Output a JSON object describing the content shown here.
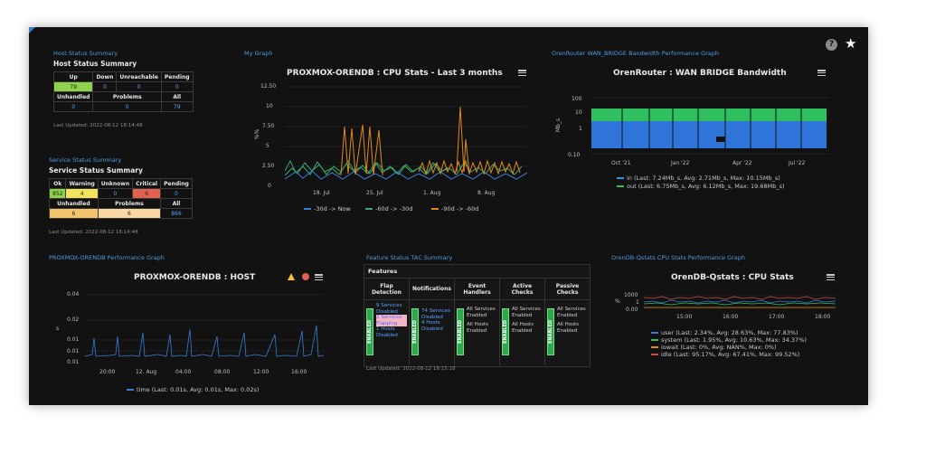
{
  "header": {
    "help_icon": "question-circle-icon",
    "star_icon": "star-icon",
    "help_glyph": "?",
    "star_glyph": "★"
  },
  "host_status": {
    "dashlet_title": "Host Status Summary",
    "heading": "Host Status Summary",
    "headers": [
      "Up",
      "Down",
      "Unreachable",
      "Pending"
    ],
    "values": [
      "79",
      "0",
      "0",
      "0"
    ],
    "sub_headers": [
      "Unhandled",
      "Problems",
      "All"
    ],
    "sub_values": [
      "0",
      "0",
      "79"
    ],
    "updated": "Last Updated: 2022-08-12 18:14:48"
  },
  "service_status": {
    "dashlet_title": "Service Status Summary",
    "heading": "Service Status Summary",
    "headers": [
      "Ok",
      "Warning",
      "Unknown",
      "Critical",
      "Pending"
    ],
    "values": [
      "852",
      "4",
      "0",
      "6",
      "0"
    ],
    "sub_headers": [
      "Unhandled",
      "Problems",
      "All"
    ],
    "sub_values": [
      "6",
      "6",
      "866"
    ],
    "updated": "Last Updated: 2022-08-12 18:14:48"
  },
  "cpu_graph": {
    "dashlet_title": "My Graph",
    "title": "PROXMOX-ORENDB : CPU Stats - Last 3 months",
    "ylabel": "%%",
    "yticks": [
      "12.50",
      "10",
      "7.50",
      "5",
      "2.50",
      "0"
    ],
    "xticks": [
      "18. Jul",
      "25. Jul",
      "1. Aug",
      "8. Aug"
    ],
    "legend": [
      {
        "label": "-30d -> Now",
        "color": "#3a7bd5"
      },
      {
        "label": "-60d -> -30d",
        "color": "#3aa86a"
      },
      {
        "label": "-90d -> -60d",
        "color": "#e08a1e"
      }
    ]
  },
  "wan_graph": {
    "dashlet_title": "OrenRouter WAN_BRIDGE Bandwidth Performance Graph",
    "title": "OrenRouter : WAN BRIDGE Bandwidth",
    "ylabel": "Mb_s",
    "yticks": [
      "100",
      "10",
      "1",
      "0.10"
    ],
    "xticks": [
      "Oct '21",
      "Jan '22",
      "Apr '22",
      "Jul '22"
    ],
    "legend": [
      {
        "label": "in (Last: 7.24Mb_s, Avg: 2.71Mb_s, Max: 10.15Mb_s)",
        "color": "#3a8fe8"
      },
      {
        "label": "out (Last: 6.75Mb_s, Avg: 6.12Mb_s, Max: 19.68Mb_s)",
        "color": "#2fbf5e"
      }
    ]
  },
  "host_graph": {
    "dashlet_title": "PROXMOX-ORENDB Performance Graph",
    "title": "PROXMOX-ORENDB : HOST",
    "ylabel": "s",
    "yticks": [
      "0.04",
      "0.02",
      "0.01",
      "0.01",
      "0.01"
    ],
    "xticks": [
      "20:00",
      "12. Aug",
      "04:00",
      "08:00",
      "12:00",
      "16:00"
    ],
    "legend": [
      {
        "label": "time (Last: 0.01s, Avg: 0.01s, Max: 0.02s)",
        "color": "#3a7bd5"
      }
    ],
    "warning_icon": "warning-triangle-icon",
    "alert_icon": "alert-circle-icon"
  },
  "feature_status": {
    "dashlet_title": "Feature Status TAC Summary",
    "heading": "Features",
    "columns": [
      {
        "label": "Flap Detection",
        "badge": "ENABLED",
        "lines": [
          "9 Services Disabled",
          "3 Services Flapping",
          "1 Hosts Disabled"
        ]
      },
      {
        "label": "Notifications",
        "badge": "ENABLED",
        "lines": [
          "74 Services Disabled",
          "4 Hosts Disabled"
        ]
      },
      {
        "label": "Event Handlers",
        "badge": "ENABLED",
        "lines": [
          "All Services Enabled",
          "All Hosts Enabled"
        ]
      },
      {
        "label": "Active Checks",
        "badge": "ENABLED",
        "lines": [
          "All Services Enabled",
          "All Hosts Enabled"
        ]
      },
      {
        "label": "Passive Checks",
        "badge": "ENABLED",
        "lines": [
          "All Services Enabled",
          "All Hosts Enabled"
        ]
      }
    ],
    "updated": "Last Updated: 2022-08-12 18:15:18"
  },
  "qstats_graph": {
    "dashlet_title": "OrenDB-Qstats CPU Stats Performance Graph",
    "title": "OrenDB-Qstats : CPU Stats",
    "ylabel": "%",
    "yticks": [
      "1000",
      "1",
      "0.00"
    ],
    "xticks": [
      "15:00",
      "16:00",
      "17:00",
      "18:00"
    ],
    "legend": [
      {
        "label": "user (Last: 2.34%, Avg: 28.63%, Max: 77.83%)",
        "color": "#3a7bd5"
      },
      {
        "label": "system (Last: 1.95%, Avg: 10.63%, Max: 34.37%)",
        "color": "#2fbf5e"
      },
      {
        "label": "iowait (Last: 0%, Avg: NAN%, Max: 0%)",
        "color": "#e08a1e"
      },
      {
        "label": "idle (Last: 95.17%, Avg: 67.41%, Max: 99.52%)",
        "color": "#d44a4a"
      }
    ]
  }
}
